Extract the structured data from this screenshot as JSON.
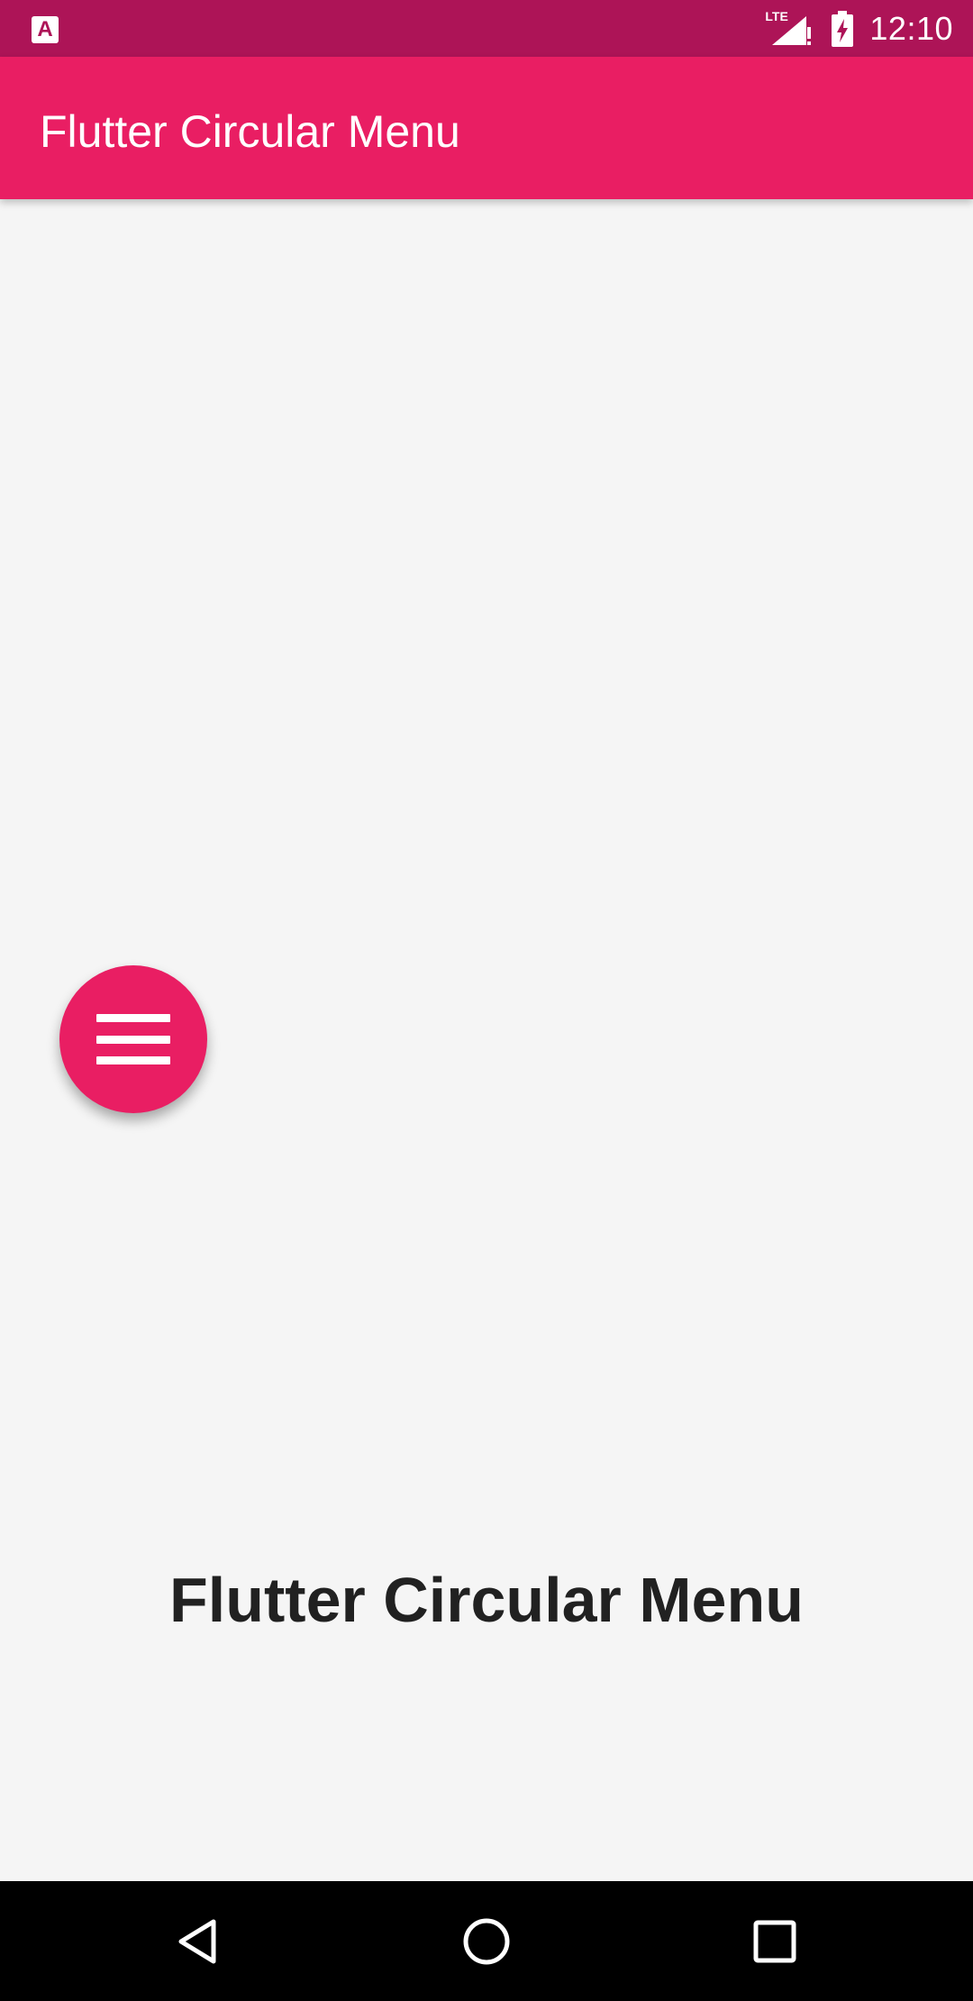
{
  "status_bar": {
    "app_icon_letter": "A",
    "network_label": "LTE",
    "time": "12:10",
    "icons": [
      "signal-icon",
      "battery-charging-icon"
    ]
  },
  "app_bar": {
    "title": "Flutter Circular Menu",
    "color": "#e91e63"
  },
  "main": {
    "center_text": "Flutter Circular Menu",
    "fab": {
      "icon": "menu-icon",
      "color": "#e91e63"
    }
  },
  "nav_bar": {
    "buttons": [
      "back-icon",
      "home-icon",
      "recent-apps-icon"
    ]
  },
  "colors": {
    "status_bar": "#ad1457",
    "primary": "#e91e63",
    "background": "#f5f5f5",
    "text": "#212121"
  }
}
